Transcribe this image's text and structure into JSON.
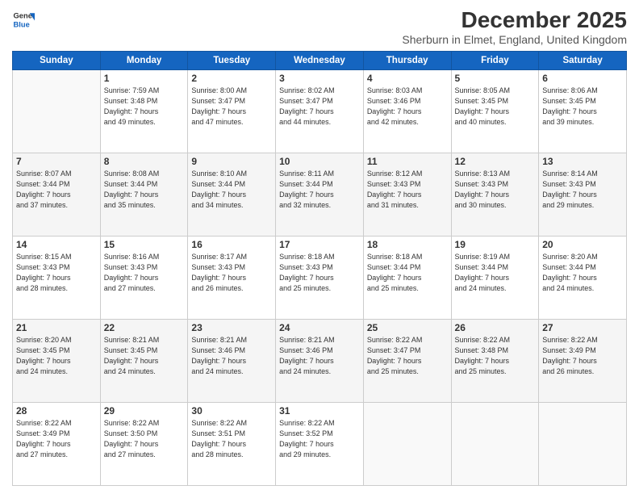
{
  "logo": {
    "line1": "General",
    "line2": "Blue"
  },
  "title": "December 2025",
  "subtitle": "Sherburn in Elmet, England, United Kingdom",
  "weekdays": [
    "Sunday",
    "Monday",
    "Tuesday",
    "Wednesday",
    "Thursday",
    "Friday",
    "Saturday"
  ],
  "weeks": [
    [
      {
        "day": "",
        "info": ""
      },
      {
        "day": "1",
        "info": "Sunrise: 7:59 AM\nSunset: 3:48 PM\nDaylight: 7 hours\nand 49 minutes."
      },
      {
        "day": "2",
        "info": "Sunrise: 8:00 AM\nSunset: 3:47 PM\nDaylight: 7 hours\nand 47 minutes."
      },
      {
        "day": "3",
        "info": "Sunrise: 8:02 AM\nSunset: 3:47 PM\nDaylight: 7 hours\nand 44 minutes."
      },
      {
        "day": "4",
        "info": "Sunrise: 8:03 AM\nSunset: 3:46 PM\nDaylight: 7 hours\nand 42 minutes."
      },
      {
        "day": "5",
        "info": "Sunrise: 8:05 AM\nSunset: 3:45 PM\nDaylight: 7 hours\nand 40 minutes."
      },
      {
        "day": "6",
        "info": "Sunrise: 8:06 AM\nSunset: 3:45 PM\nDaylight: 7 hours\nand 39 minutes."
      }
    ],
    [
      {
        "day": "7",
        "info": "Sunrise: 8:07 AM\nSunset: 3:44 PM\nDaylight: 7 hours\nand 37 minutes."
      },
      {
        "day": "8",
        "info": "Sunrise: 8:08 AM\nSunset: 3:44 PM\nDaylight: 7 hours\nand 35 minutes."
      },
      {
        "day": "9",
        "info": "Sunrise: 8:10 AM\nSunset: 3:44 PM\nDaylight: 7 hours\nand 34 minutes."
      },
      {
        "day": "10",
        "info": "Sunrise: 8:11 AM\nSunset: 3:44 PM\nDaylight: 7 hours\nand 32 minutes."
      },
      {
        "day": "11",
        "info": "Sunrise: 8:12 AM\nSunset: 3:43 PM\nDaylight: 7 hours\nand 31 minutes."
      },
      {
        "day": "12",
        "info": "Sunrise: 8:13 AM\nSunset: 3:43 PM\nDaylight: 7 hours\nand 30 minutes."
      },
      {
        "day": "13",
        "info": "Sunrise: 8:14 AM\nSunset: 3:43 PM\nDaylight: 7 hours\nand 29 minutes."
      }
    ],
    [
      {
        "day": "14",
        "info": "Sunrise: 8:15 AM\nSunset: 3:43 PM\nDaylight: 7 hours\nand 28 minutes."
      },
      {
        "day": "15",
        "info": "Sunrise: 8:16 AM\nSunset: 3:43 PM\nDaylight: 7 hours\nand 27 minutes."
      },
      {
        "day": "16",
        "info": "Sunrise: 8:17 AM\nSunset: 3:43 PM\nDaylight: 7 hours\nand 26 minutes."
      },
      {
        "day": "17",
        "info": "Sunrise: 8:18 AM\nSunset: 3:43 PM\nDaylight: 7 hours\nand 25 minutes."
      },
      {
        "day": "18",
        "info": "Sunrise: 8:18 AM\nSunset: 3:44 PM\nDaylight: 7 hours\nand 25 minutes."
      },
      {
        "day": "19",
        "info": "Sunrise: 8:19 AM\nSunset: 3:44 PM\nDaylight: 7 hours\nand 24 minutes."
      },
      {
        "day": "20",
        "info": "Sunrise: 8:20 AM\nSunset: 3:44 PM\nDaylight: 7 hours\nand 24 minutes."
      }
    ],
    [
      {
        "day": "21",
        "info": "Sunrise: 8:20 AM\nSunset: 3:45 PM\nDaylight: 7 hours\nand 24 minutes."
      },
      {
        "day": "22",
        "info": "Sunrise: 8:21 AM\nSunset: 3:45 PM\nDaylight: 7 hours\nand 24 minutes."
      },
      {
        "day": "23",
        "info": "Sunrise: 8:21 AM\nSunset: 3:46 PM\nDaylight: 7 hours\nand 24 minutes."
      },
      {
        "day": "24",
        "info": "Sunrise: 8:21 AM\nSunset: 3:46 PM\nDaylight: 7 hours\nand 24 minutes."
      },
      {
        "day": "25",
        "info": "Sunrise: 8:22 AM\nSunset: 3:47 PM\nDaylight: 7 hours\nand 25 minutes."
      },
      {
        "day": "26",
        "info": "Sunrise: 8:22 AM\nSunset: 3:48 PM\nDaylight: 7 hours\nand 25 minutes."
      },
      {
        "day": "27",
        "info": "Sunrise: 8:22 AM\nSunset: 3:49 PM\nDaylight: 7 hours\nand 26 minutes."
      }
    ],
    [
      {
        "day": "28",
        "info": "Sunrise: 8:22 AM\nSunset: 3:49 PM\nDaylight: 7 hours\nand 27 minutes."
      },
      {
        "day": "29",
        "info": "Sunrise: 8:22 AM\nSunset: 3:50 PM\nDaylight: 7 hours\nand 27 minutes."
      },
      {
        "day": "30",
        "info": "Sunrise: 8:22 AM\nSunset: 3:51 PM\nDaylight: 7 hours\nand 28 minutes."
      },
      {
        "day": "31",
        "info": "Sunrise: 8:22 AM\nSunset: 3:52 PM\nDaylight: 7 hours\nand 29 minutes."
      },
      {
        "day": "",
        "info": ""
      },
      {
        "day": "",
        "info": ""
      },
      {
        "day": "",
        "info": ""
      }
    ]
  ]
}
